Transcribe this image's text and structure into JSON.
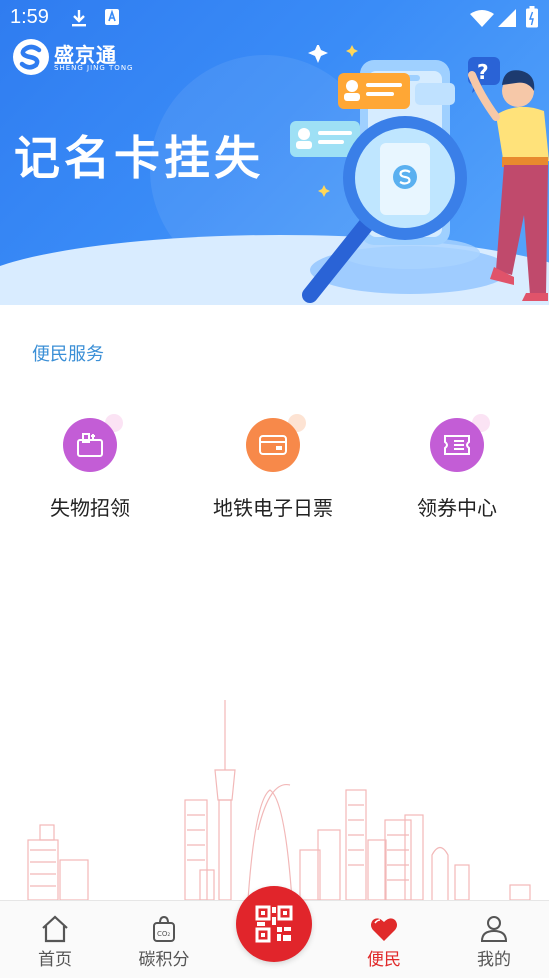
{
  "status_bar": {
    "time": "1:59"
  },
  "app": {
    "logo_cn": "盛京通",
    "logo_en": "SHENG JING TONG"
  },
  "banner": {
    "title": "记名卡挂失"
  },
  "services": {
    "title": "便民服务",
    "items": [
      {
        "label": "失物招领",
        "icon": "lost-found-icon",
        "color": "#c35dd6"
      },
      {
        "label": "地铁电子日票",
        "icon": "metro-ticket-icon",
        "color": "#f7894a"
      },
      {
        "label": "领券中心",
        "icon": "coupon-icon",
        "color": "#c35dd6"
      }
    ]
  },
  "nav": {
    "items": [
      {
        "label": "首页",
        "icon": "home-icon"
      },
      {
        "label": "碳积分",
        "icon": "carbon-points-icon"
      },
      {
        "label": "",
        "icon": "qr-code-icon"
      },
      {
        "label": "便民",
        "icon": "heart-icon",
        "active": true
      },
      {
        "label": "我的",
        "icon": "profile-icon"
      }
    ]
  },
  "colors": {
    "accent": "#e1252b",
    "banner_blue": "#3a8cf7",
    "section_title": "#3b8fd6"
  }
}
